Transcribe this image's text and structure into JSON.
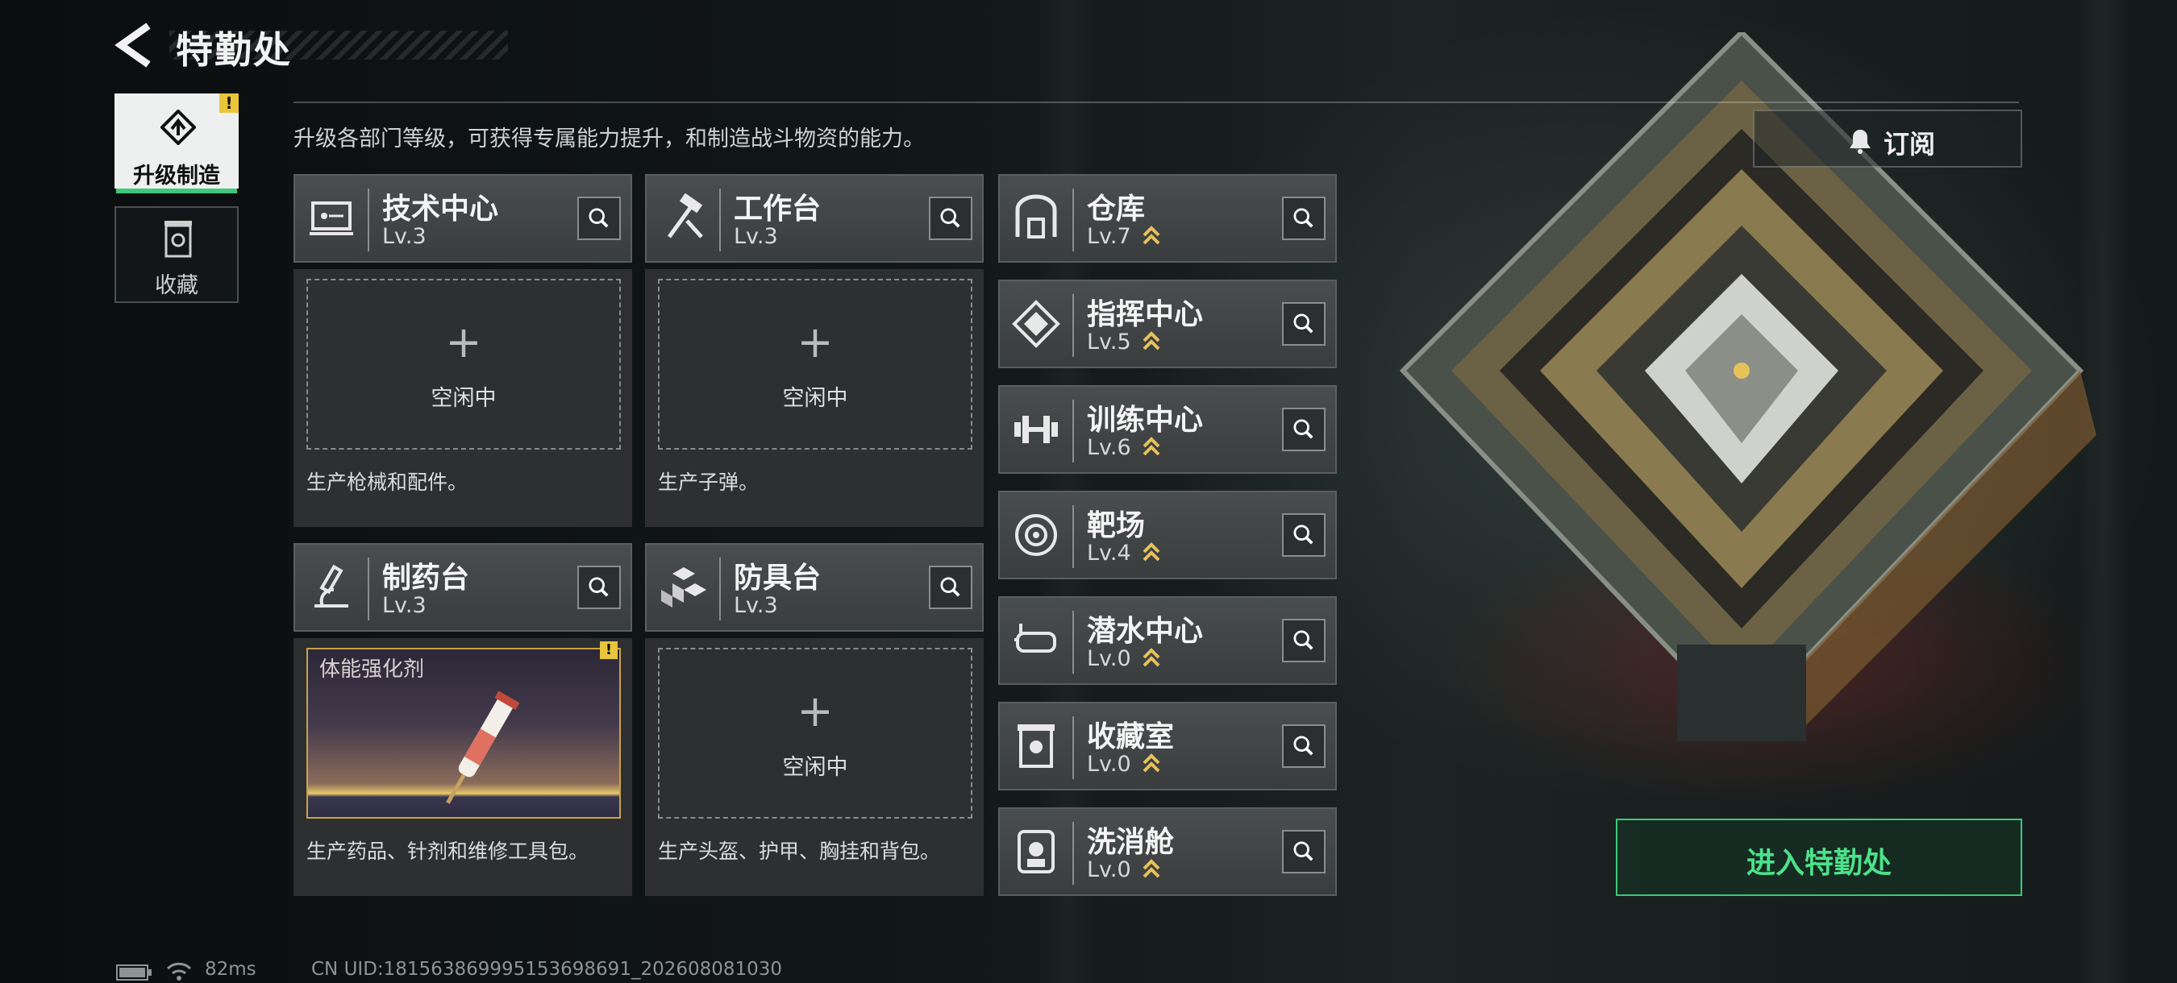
{
  "header": {
    "title": "特勤处"
  },
  "tabs": [
    {
      "label": "升级制造",
      "active": true,
      "icon": "upgrade-icon"
    },
    {
      "label": "收藏",
      "active": false,
      "icon": "collection-icon"
    }
  ],
  "description": "升级各部门等级，可获得专属能力提升，和制造战斗物资的能力。",
  "subscribe": {
    "label": "订阅",
    "icon": "bell-icon"
  },
  "workstations": [
    {
      "name": "技术中心",
      "level": "Lv.3",
      "icon": "tech-center-icon",
      "slot_state": "空闲中",
      "footer": "生产枪械和配件。"
    },
    {
      "name": "工作台",
      "level": "Lv.3",
      "icon": "workbench-icon",
      "slot_state": "空闲中",
      "footer": "生产子弹。"
    },
    {
      "name": "制药台",
      "level": "Lv.3",
      "icon": "pharmacy-icon",
      "slot_item": "体能强化剂",
      "footer": "生产药品、针剂和维修工具包。"
    },
    {
      "name": "防具台",
      "level": "Lv.3",
      "icon": "armor-bench-icon",
      "slot_state": "空闲中",
      "footer": "生产头盔、护甲、胸挂和背包。"
    }
  ],
  "departments": [
    {
      "name": "仓库",
      "level": "Lv.7",
      "icon": "warehouse-icon",
      "upgradable": true
    },
    {
      "name": "指挥中心",
      "level": "Lv.5",
      "icon": "command-center-icon",
      "upgradable": true
    },
    {
      "name": "训练中心",
      "level": "Lv.6",
      "icon": "training-center-icon",
      "upgradable": true
    },
    {
      "name": "靶场",
      "level": "Lv.4",
      "icon": "shooting-range-icon",
      "upgradable": true
    },
    {
      "name": "潜水中心",
      "level": "Lv.0",
      "icon": "diving-center-icon",
      "upgradable": true
    },
    {
      "name": "收藏室",
      "level": "Lv.0",
      "icon": "collection-room-icon",
      "upgradable": true
    },
    {
      "name": "洗消舱",
      "level": "Lv.0",
      "icon": "decontamination-icon",
      "upgradable": true
    }
  ],
  "enter_button": "进入特勤处",
  "status_bar": {
    "ping": "82ms",
    "uid": "CN UID:181563869995153698691_202608081030"
  },
  "colors": {
    "accent_green": "#3ec97a",
    "warning_yellow": "#e8c53a",
    "upgrade_gold": "#e6c25a"
  }
}
